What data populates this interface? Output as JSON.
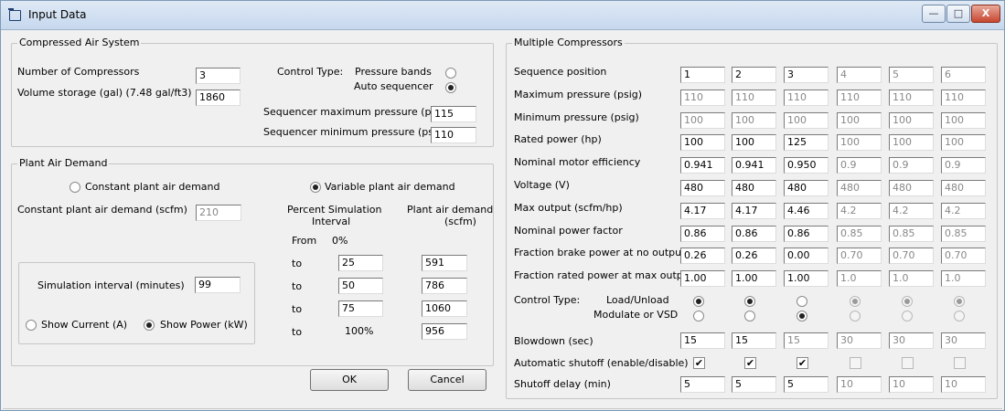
{
  "window": {
    "title": "Input Data",
    "minimize_glyph": "—",
    "maximize_glyph": "□",
    "close_glyph": "X"
  },
  "compressed_air_system": {
    "title": "Compressed Air System",
    "num_compressors_label": "Number of Compressors",
    "num_compressors_value": "3",
    "volume_label": "Volume storage (gal) (7.48 gal/ft3)",
    "volume_value": "1860",
    "control_type_label": "Control Type:",
    "pressure_bands_label": "Pressure bands",
    "auto_sequencer_label": "Auto sequencer",
    "selected_control": "auto_sequencer",
    "seq_max_label": "Sequencer maximum pressure (psig)",
    "seq_max_value": "115",
    "seq_min_label": "Sequencer minimum pressure (psig)",
    "seq_min_value": "110"
  },
  "plant_air_demand": {
    "title": "Plant Air Demand",
    "constant_label": "Constant plant air demand",
    "variable_label": "Variable plant air demand",
    "selected": "variable",
    "constant_scfm_label": "Constant plant air demand (scfm)",
    "constant_scfm_value": "210",
    "percent_header_line1": "Percent Simulation",
    "percent_header_line2": "Interval",
    "demand_header_line1": "Plant air demand",
    "demand_header_line2": "(scfm)",
    "from_label": "From",
    "from_value": "0%",
    "rows": [
      {
        "label": "to",
        "percent": "25",
        "demand": "591"
      },
      {
        "label": "to",
        "percent": "50",
        "demand": "786"
      },
      {
        "label": "to",
        "percent": "75",
        "demand": "1060"
      },
      {
        "label": "to",
        "percent": "100%",
        "demand": "956"
      }
    ]
  },
  "simulation": {
    "interval_label": "Simulation interval (minutes)",
    "interval_value": "99",
    "show_current_label": "Show Current (A)",
    "show_power_label": "Show Power (kW)",
    "selected": "power"
  },
  "buttons": {
    "ok": "OK",
    "cancel": "Cancel"
  },
  "multiple_compressors": {
    "title": "Multiple Compressors",
    "active_columns": 3,
    "rows": [
      {
        "label": "Sequence position",
        "values": [
          "1",
          "2",
          "3",
          "4",
          "5",
          "6"
        ],
        "enabled": [
          true,
          true,
          true,
          false,
          false,
          false
        ]
      },
      {
        "label": "Maximum pressure (psig)",
        "values": [
          "110",
          "110",
          "110",
          "110",
          "110",
          "110"
        ],
        "enabled": [
          false,
          false,
          false,
          false,
          false,
          false
        ]
      },
      {
        "label": "Minimum pressure (psig)",
        "values": [
          "100",
          "100",
          "100",
          "100",
          "100",
          "100"
        ],
        "enabled": [
          false,
          false,
          false,
          false,
          false,
          false
        ]
      },
      {
        "label": "Rated power (hp)",
        "values": [
          "100",
          "100",
          "125",
          "100",
          "100",
          "100"
        ],
        "enabled": [
          true,
          true,
          true,
          false,
          false,
          false
        ]
      },
      {
        "label": "Nominal motor efficiency",
        "values": [
          "0.941",
          "0.941",
          "0.950",
          "0.9",
          "0.9",
          "0.9"
        ],
        "enabled": [
          true,
          true,
          true,
          false,
          false,
          false
        ]
      },
      {
        "label": "Voltage (V)",
        "values": [
          "480",
          "480",
          "480",
          "480",
          "480",
          "480"
        ],
        "enabled": [
          true,
          true,
          true,
          false,
          false,
          false
        ]
      },
      {
        "label": "Max output (scfm/hp)",
        "values": [
          "4.17",
          "4.17",
          "4.46",
          "4.2",
          "4.2",
          "4.2"
        ],
        "enabled": [
          true,
          true,
          true,
          false,
          false,
          false
        ]
      },
      {
        "label": "Nominal power factor",
        "values": [
          "0.86",
          "0.86",
          "0.86",
          "0.85",
          "0.85",
          "0.85"
        ],
        "enabled": [
          true,
          true,
          true,
          false,
          false,
          false
        ]
      },
      {
        "label": "Fraction brake power at no output",
        "values": [
          "0.26",
          "0.26",
          "0.00",
          "0.70",
          "0.70",
          "0.70"
        ],
        "enabled": [
          true,
          true,
          true,
          false,
          false,
          false
        ]
      },
      {
        "label": "Fraction rated power at max output",
        "values": [
          "1.00",
          "1.00",
          "1.00",
          "1.0",
          "1.0",
          "1.0"
        ],
        "enabled": [
          true,
          true,
          true,
          false,
          false,
          false
        ]
      }
    ],
    "control_type_label": "Control Type:",
    "load_unload_label": "Load/Unload",
    "modulate_label": "Modulate or VSD",
    "control_selection": [
      "load_unload",
      "load_unload",
      "modulate",
      "load_unload",
      "load_unload",
      "load_unload"
    ],
    "blowdown_label": "Blowdown (sec)",
    "blowdown_values": [
      "15",
      "15",
      "15",
      "30",
      "30",
      "30"
    ],
    "blowdown_enabled": [
      true,
      true,
      false,
      false,
      false,
      false
    ],
    "auto_shutoff_label": "Automatic shutoff (enable/disable)",
    "auto_shutoff_checked": [
      true,
      true,
      true,
      false,
      false,
      false
    ],
    "shutoff_delay_label": "Shutoff delay (min)",
    "shutoff_delay_values": [
      "5",
      "5",
      "5",
      "10",
      "10",
      "10"
    ],
    "shutoff_delay_enabled": [
      true,
      true,
      true,
      false,
      false,
      false
    ]
  }
}
